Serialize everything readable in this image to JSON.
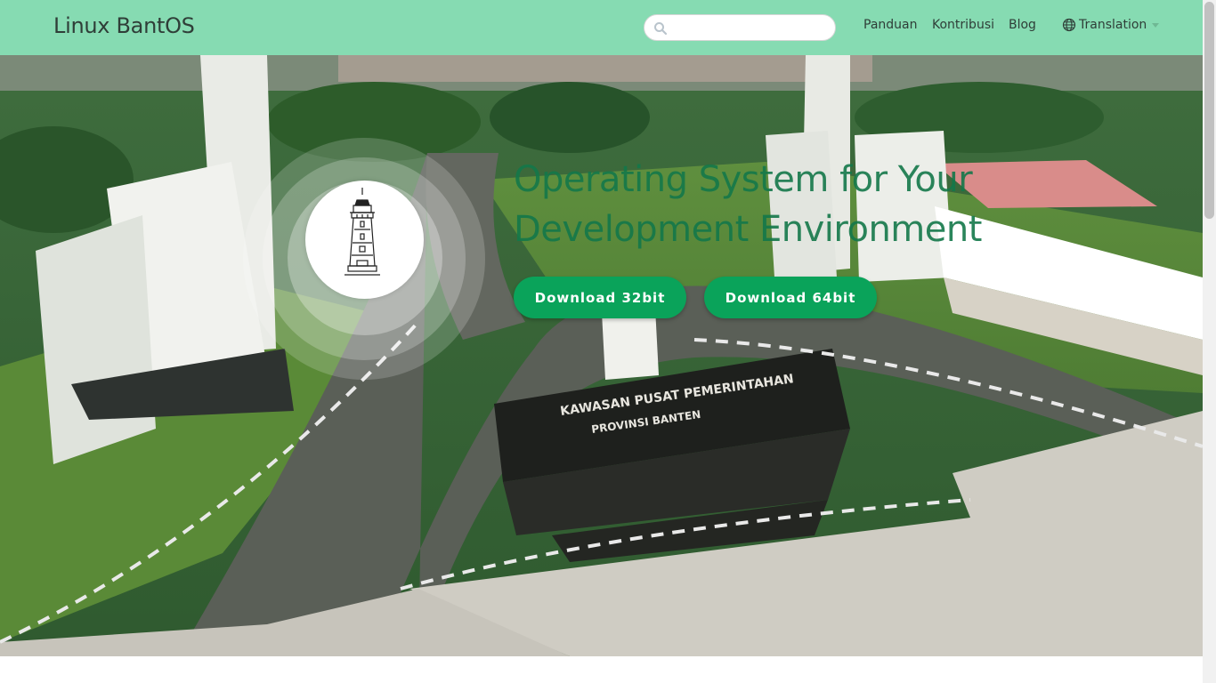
{
  "navbar": {
    "brand": "Linux BantOS",
    "search": {
      "placeholder": "",
      "value": ""
    },
    "links": [
      {
        "label": "Panduan"
      },
      {
        "label": "Kontribusi"
      },
      {
        "label": "Blog"
      }
    ],
    "translation_label": "Translation",
    "background_color": "#86dbb2"
  },
  "hero": {
    "headline_line1": "Operating System for Your",
    "headline_line2": "Development Environment",
    "download_32_label": "Download 32bit",
    "download_64_label": "Download 64bit",
    "button_color": "#0aa35a",
    "headline_color": "#14784a",
    "background_photo": {
      "monument_sign_line1": "KAWASAN PUSAT PEMERINTAHAN",
      "monument_sign_line2": "PROVINSI BANTEN"
    }
  },
  "icons": {
    "search": "search-icon",
    "translation": "globe-icon",
    "dropdown": "chevron-down-icon",
    "logo": "lighthouse-tower-logo"
  }
}
